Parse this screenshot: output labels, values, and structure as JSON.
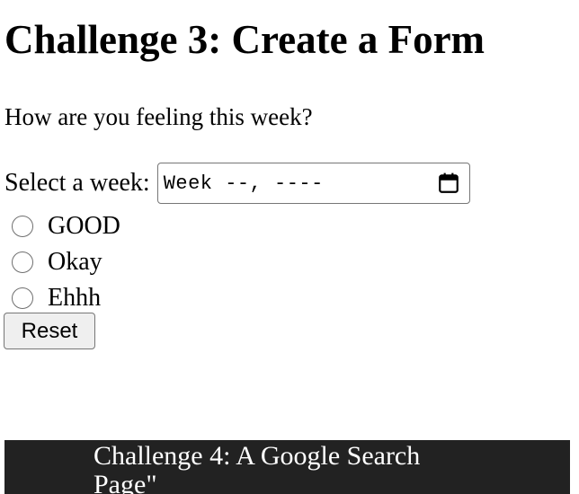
{
  "page": {
    "title": "Challenge 3: Create a Form",
    "question": "How are you feeling this week?"
  },
  "form": {
    "week_label": "Select a week:",
    "week_value": "Week --, ----",
    "week_icon": "calendar-icon",
    "options": [
      {
        "label": "GOOD",
        "selected": false
      },
      {
        "label": "Okay",
        "selected": false
      },
      {
        "label": "Ehhh",
        "selected": false
      }
    ],
    "reset_label": "Reset"
  },
  "footer": {
    "text": "Challenge 4: A Google Search Page\"",
    "background": "#222222"
  }
}
